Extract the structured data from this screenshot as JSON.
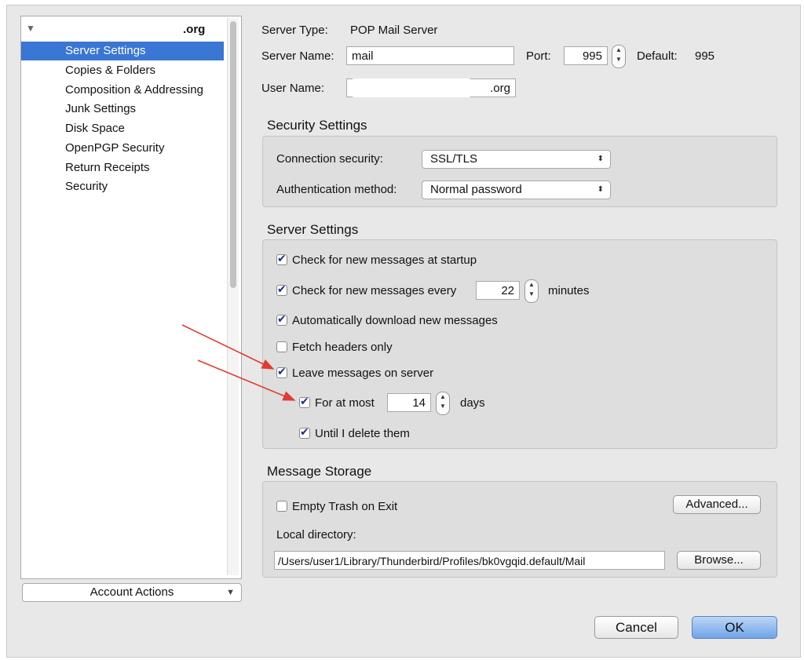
{
  "sidebar": {
    "account_name": ".org",
    "items": [
      {
        "label": "Server Settings",
        "selected": true
      },
      {
        "label": "Copies & Folders"
      },
      {
        "label": "Composition & Addressing"
      },
      {
        "label": "Junk Settings"
      },
      {
        "label": "Disk Space"
      },
      {
        "label": "OpenPGP Security"
      },
      {
        "label": "Return Receipts"
      },
      {
        "label": "Security"
      }
    ],
    "account_actions": "Account Actions"
  },
  "server": {
    "type_label": "Server Type:",
    "type_value": "POP Mail Server",
    "name_label": "Server Name:",
    "name_value": "mail",
    "port_label": "Port:",
    "port_value": "995",
    "default_label": "Default:",
    "default_value": "995",
    "user_label": "User Name:",
    "user_value": ".org"
  },
  "security": {
    "title": "Security Settings",
    "conn_label": "Connection security:",
    "conn_value": "SSL/TLS",
    "auth_label": "Authentication method:",
    "auth_value": "Normal password"
  },
  "settings": {
    "title": "Server Settings",
    "startup": {
      "label": "Check for new messages at startup",
      "checked": true
    },
    "every": {
      "label": "Check for new messages every",
      "checked": true,
      "value": "22",
      "unit": "minutes"
    },
    "auto_download": {
      "label": "Automatically download new messages",
      "checked": true
    },
    "headers_only": {
      "label": "Fetch headers only",
      "checked": false
    },
    "leave": {
      "label": "Leave messages on server",
      "checked": true
    },
    "for_at_most": {
      "label": "For at most",
      "checked": true,
      "value": "14",
      "unit": "days"
    },
    "until_delete": {
      "label": "Until I delete them",
      "checked": true
    }
  },
  "storage": {
    "title": "Message Storage",
    "empty_trash": {
      "label": "Empty Trash on Exit",
      "checked": false
    },
    "advanced": "Advanced...",
    "local_dir_label": "Local directory:",
    "local_dir_value": "/Users/user1/Library/Thunderbird/Profiles/bk0vgqid.default/Mail",
    "browse": "Browse..."
  },
  "footer": {
    "cancel": "Cancel",
    "ok": "OK"
  },
  "colors": {
    "selection": "#3a76d3",
    "annotation_arrow": "#e03c31"
  }
}
